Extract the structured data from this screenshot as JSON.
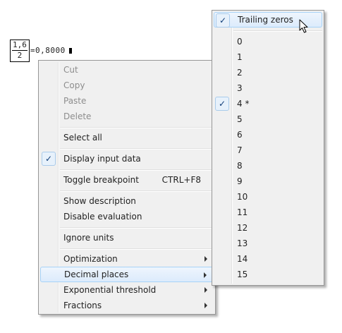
{
  "formula": {
    "numerator": "1,6",
    "denominator": "2",
    "result": "=0,8000"
  },
  "context_menu": {
    "items": [
      {
        "label": "Cut",
        "disabled": true
      },
      {
        "label": "Copy",
        "disabled": true
      },
      {
        "label": "Paste",
        "disabled": true
      },
      {
        "label": "Delete",
        "disabled": true
      },
      {
        "label": "Select all"
      },
      {
        "label": "Display input data",
        "checked": true
      },
      {
        "label": "Toggle breakpoint",
        "shortcut": "CTRL+F8"
      },
      {
        "label": "Show description"
      },
      {
        "label": "Disable evaluation"
      },
      {
        "label": "Ignore units"
      },
      {
        "label": "Optimization",
        "submenu": true
      },
      {
        "label": "Decimal places",
        "submenu": true,
        "highlighted": true
      },
      {
        "label": "Exponential threshold",
        "submenu": true
      },
      {
        "label": "Fractions",
        "submenu": true
      }
    ]
  },
  "submenu": {
    "items": [
      {
        "label": "Trailing zeros",
        "checked": true,
        "highlighted": true
      },
      {
        "label": "0"
      },
      {
        "label": "1"
      },
      {
        "label": "2"
      },
      {
        "label": "3"
      },
      {
        "label": "4 *",
        "checked": true
      },
      {
        "label": "5"
      },
      {
        "label": "6"
      },
      {
        "label": "7"
      },
      {
        "label": "8"
      },
      {
        "label": "9"
      },
      {
        "label": "10"
      },
      {
        "label": "11"
      },
      {
        "label": "12"
      },
      {
        "label": "13"
      },
      {
        "label": "14"
      },
      {
        "label": "15"
      }
    ]
  },
  "icons": {
    "check": "✓",
    "submenu_arrow": "chevron-right-icon",
    "mouse_pointer": "arrow-cursor-icon"
  },
  "colors": {
    "menu_background": "#f0f0f0",
    "highlight_border": "#a8d3f7",
    "disabled_text": "#8d8d8d"
  }
}
